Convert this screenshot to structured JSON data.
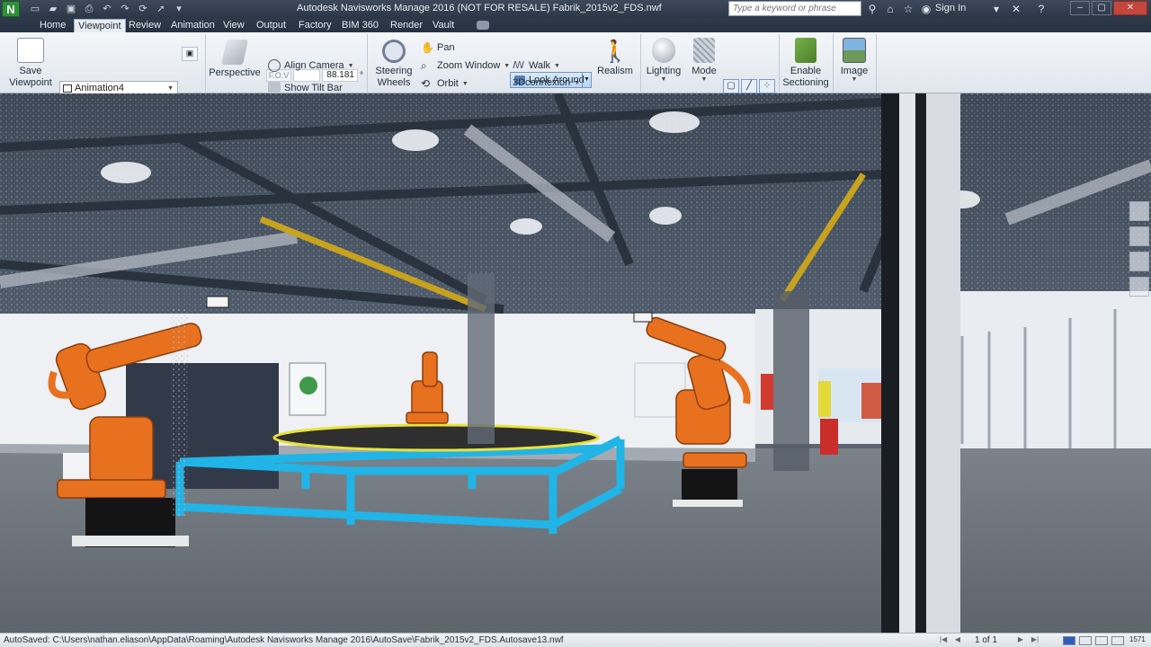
{
  "app": {
    "logo_letter": "N",
    "title": "Autodesk Navisworks Manage 2016 (NOT FOR RESALE)    Fabrik_2015v2_FDS.nwf",
    "search_placeholder": "Type a keyword or phrase",
    "sign_in": "Sign In"
  },
  "tabs": [
    "Home",
    "Viewpoint",
    "Review",
    "Animation",
    "View",
    "Output",
    "Factory",
    "BIM 360",
    "Render",
    "Vault"
  ],
  "active_tab": "Viewpoint",
  "ribbon": {
    "save_viewpoint": "Save\nViewpoint",
    "animation_select": "Animation4",
    "perspective": "Perspective",
    "fov_label": "F.O.V",
    "fov_value": "88.181",
    "fov_unit": "°",
    "align_camera": "Align Camera",
    "show_tilt_bar": "Show Tilt Bar",
    "steering_wheels": "Steering\nWheels",
    "pan": "Pan",
    "zoom_window": "Zoom Window",
    "orbit": "Orbit",
    "look_around": "Look Around",
    "walk": "Walk",
    "connexion": "3Dconnexion",
    "realism": "Realism",
    "lighting": "Lighting",
    "mode": "Mode",
    "enable_sectioning": "Enable\nSectioning",
    "image": "Image"
  },
  "status": {
    "autosave_path": "AutoSaved: C:\\Users\\nathan.eliason\\AppData\\Roaming\\Autodesk Navisworks Manage 2016\\AutoSave\\Fabrik_2015v2_FDS.Autosave13.nwf",
    "pages": "1 of 1",
    "memory": "1571"
  },
  "colors": {
    "robot_orange": "#e8711f",
    "table_cyan": "#21b4e6",
    "wall_white": "#f2f3f5",
    "floor_grey": "#6d737b",
    "look_around_active": "#b9d3ef"
  }
}
